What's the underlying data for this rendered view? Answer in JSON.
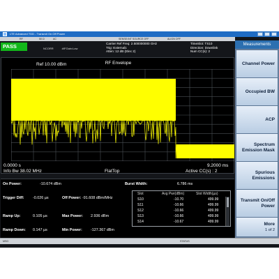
{
  "window": {
    "title": "LTE Advanced TDD - Transmit On Off Power"
  },
  "status_line": {
    "items": [
      "RF",
      "50 Ω",
      "AC",
      "SENSE:INT SOURCE OFF",
      "ALIGN OFF"
    ]
  },
  "measurement": {
    "verdict": "PASS",
    "settings": [
      "NCORR",
      "#IFGain:Low"
    ],
    "carrier": [
      "Carrier Ref Freq: 2.500000000 GHz",
      "Trig: External1",
      "Atten: 12 dB (Elec 2)"
    ],
    "timeslot": [
      "TimeSlot: TS10",
      "Direction: Downlink",
      "Num CC(s): 2"
    ]
  },
  "plot": {
    "title": "RF Envelope",
    "ref_level": "Ref  10.00 dBm",
    "x_start": "0.0000 s",
    "x_stop": "9.2000 ms",
    "info_bw": "Info Bw 38.02 MHz",
    "window": "FlatTop",
    "active_cc": "Active CC(s) : 2",
    "trace_color": "#ffff00"
  },
  "results": {
    "on_power": {
      "label": "On Power:",
      "value": "-10.674 dBm"
    },
    "burst_width": {
      "label": "Burst Width:",
      "value": "6.786 ms"
    },
    "trigger_diff": {
      "label": "Trigger Diff:",
      "value": "-0.026 µs"
    },
    "off_power": {
      "label": "Off Power:",
      "value": "-91.608 dBm/MHz"
    },
    "ramp_up": {
      "label": "Ramp Up:",
      "value": "0.105 µs"
    },
    "max_power": {
      "label": "Max Power:",
      "value": "2.936 dBm"
    },
    "ramp_down": {
      "label": "Ramp Down:",
      "value": "0.147 µs"
    },
    "min_power": {
      "label": "Min Power:",
      "value": "-127.367 dBm"
    }
  },
  "slot_table": {
    "headers": [
      "Slot",
      "Avg Pwr(dBm)",
      "Slot Width(µs)"
    ],
    "rows": [
      [
        "S10",
        "-10.70",
        "499.99"
      ],
      [
        "S11",
        "-10.66",
        "499.99"
      ],
      [
        "S12",
        "-10.66",
        "499.99"
      ],
      [
        "S13",
        "-10.66",
        "499.99"
      ],
      [
        "S14",
        "-10.67",
        "499.99"
      ]
    ]
  },
  "bottom_bar": {
    "msg": "MSG",
    "status": "STATUS"
  },
  "softkeys": {
    "header": "Measurements",
    "keys": [
      {
        "label": "Channel Power",
        "sub": ""
      },
      {
        "label": "Occupied BW",
        "sub": ""
      },
      {
        "label": "ACP",
        "sub": ""
      },
      {
        "label": "Spectrum Emission Mask",
        "sub": ""
      },
      {
        "label": "Spurious Emissions",
        "sub": ""
      },
      {
        "label": "Transmit On/Off Power",
        "sub": ""
      },
      {
        "label": "More",
        "sub": "1 of 2"
      }
    ]
  }
}
